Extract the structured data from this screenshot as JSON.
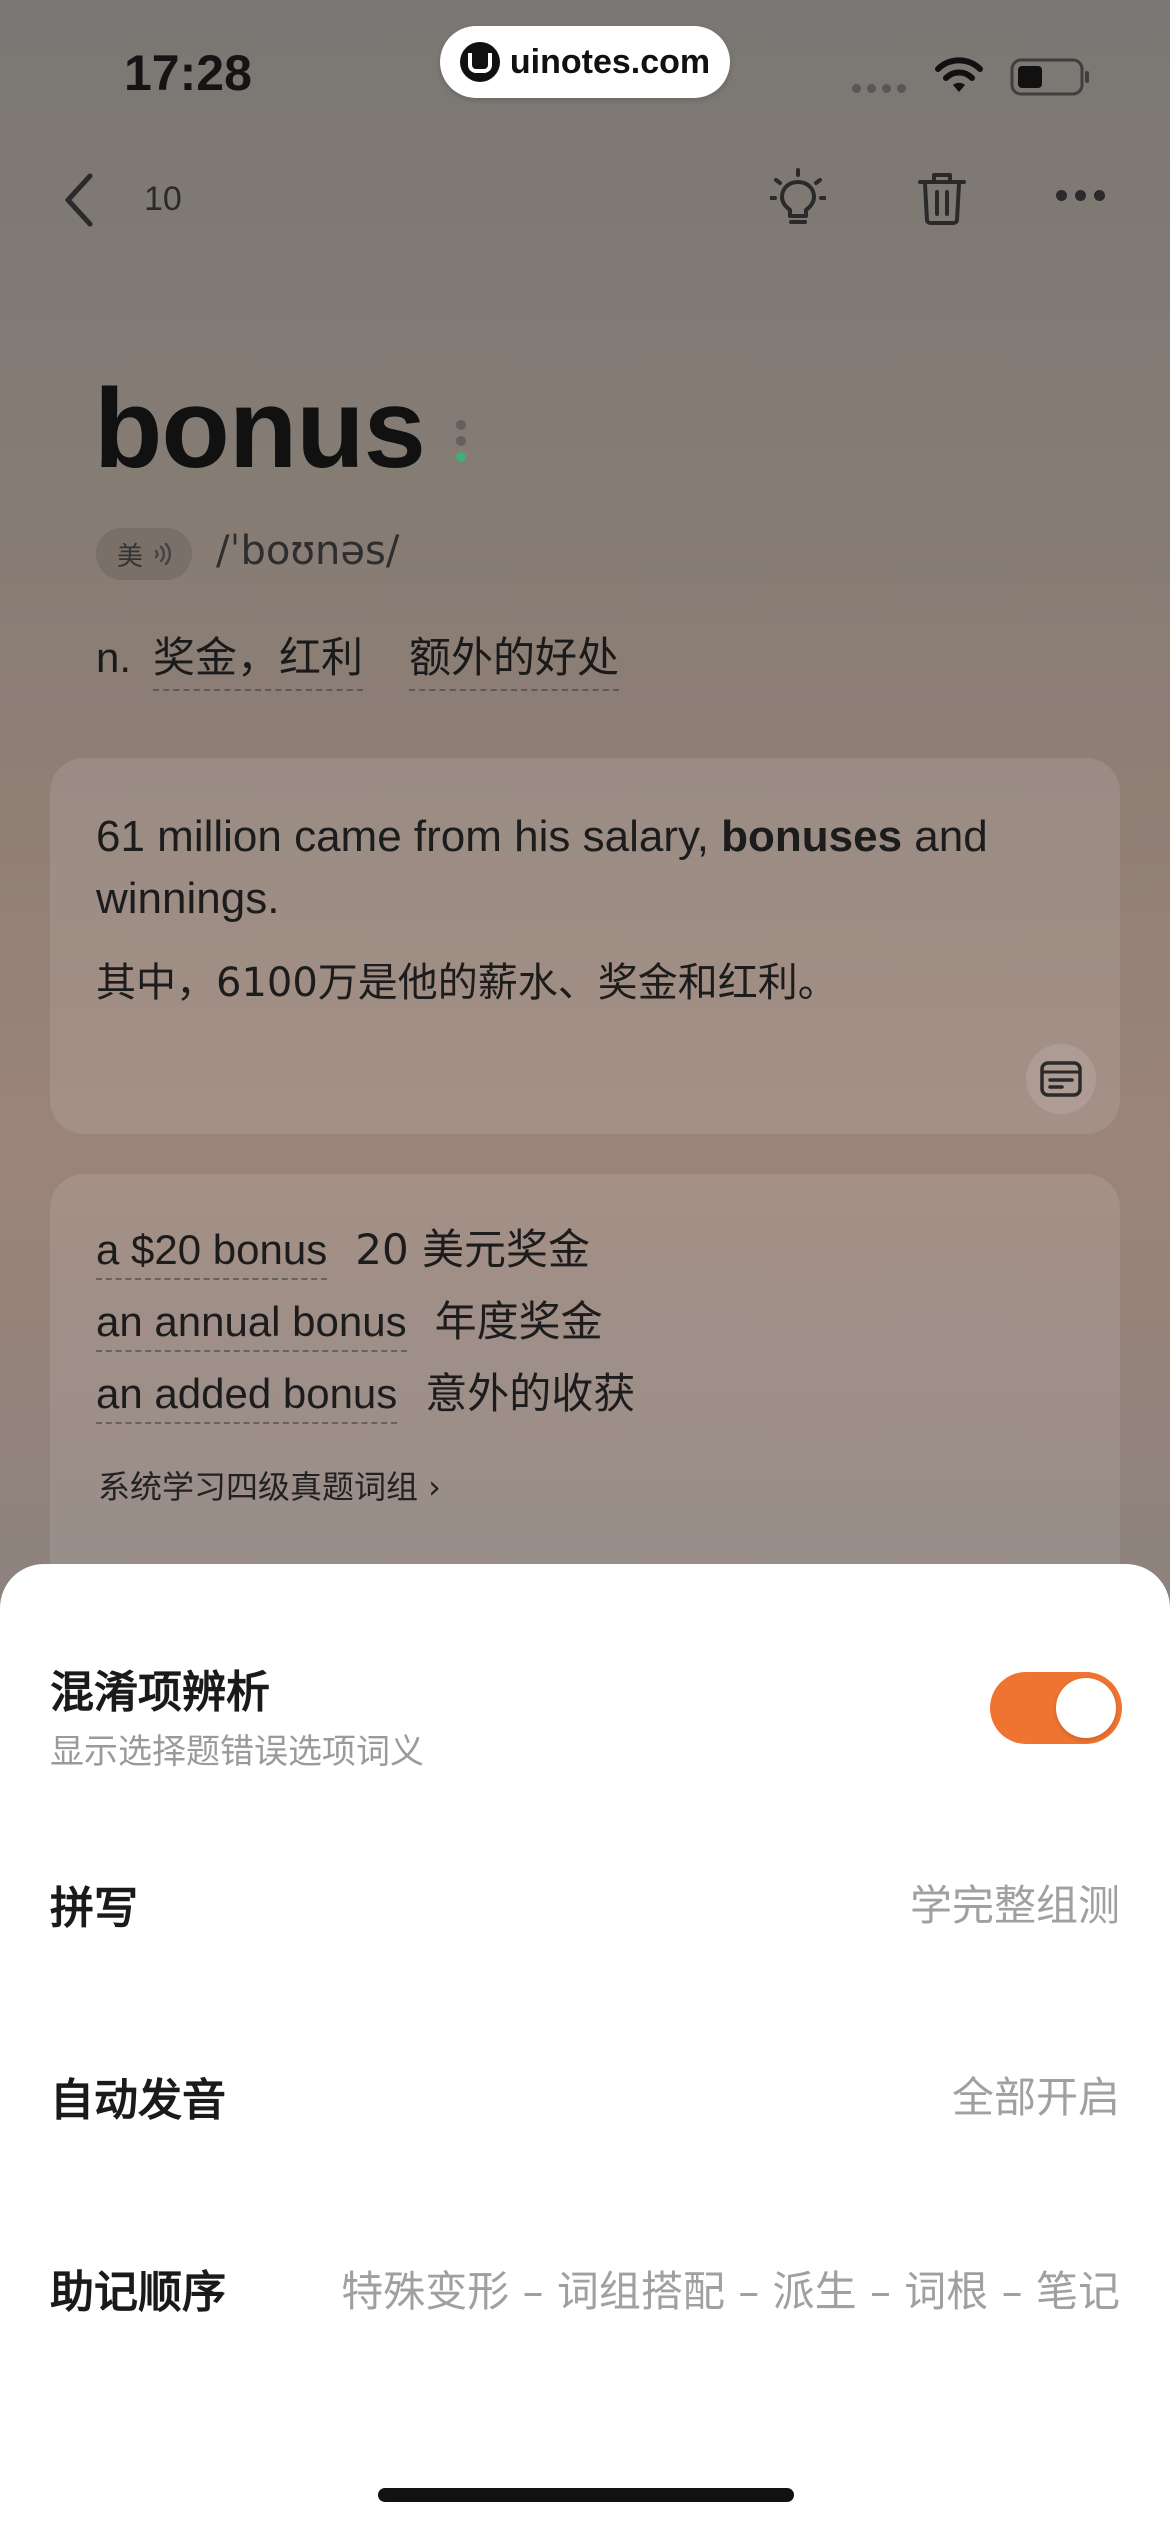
{
  "status_bar": {
    "time": "17:28",
    "watermark": "uinotes.com"
  },
  "nav": {
    "count": "10",
    "icons": [
      "back-icon",
      "bulb-icon",
      "trash-icon",
      "more-icon"
    ]
  },
  "word": {
    "text": "bonus",
    "accent": "美",
    "phonetic": "/ˈboʊnəs/",
    "pos": "n.",
    "meanings": [
      "奖金，红利",
      "额外的好处"
    ]
  },
  "example": {
    "en_before": "61 million came from his salary, ",
    "en_bold": "bonuses",
    "en_after": " and winnings.",
    "zh": "其中，6100万是他的薪水、奖金和红利。"
  },
  "phrases": [
    {
      "en": "a $20 bonus",
      "zh": "20 美元奖金"
    },
    {
      "en": "an annual bonus",
      "zh": "年度奖金"
    },
    {
      "en": "an added bonus",
      "zh": "意外的收获"
    }
  ],
  "group_link": "系统学习四级真题词组 ›",
  "settings": {
    "confusion": {
      "title": "混淆项辨析",
      "subtitle": "显示选择题错误选项词义",
      "enabled": true
    },
    "spelling": {
      "title": "拼写",
      "value": "学完整组测"
    },
    "auto_pronounce": {
      "title": "自动发音",
      "value": "全部开启"
    },
    "mnemonic": {
      "title": "助记顺序",
      "value": "特殊变形 – 词组搭配 – 派生 – 词根 – 笔记"
    }
  },
  "colors": {
    "accent": "#ef7331",
    "sheet_bg": "#ffffff"
  }
}
